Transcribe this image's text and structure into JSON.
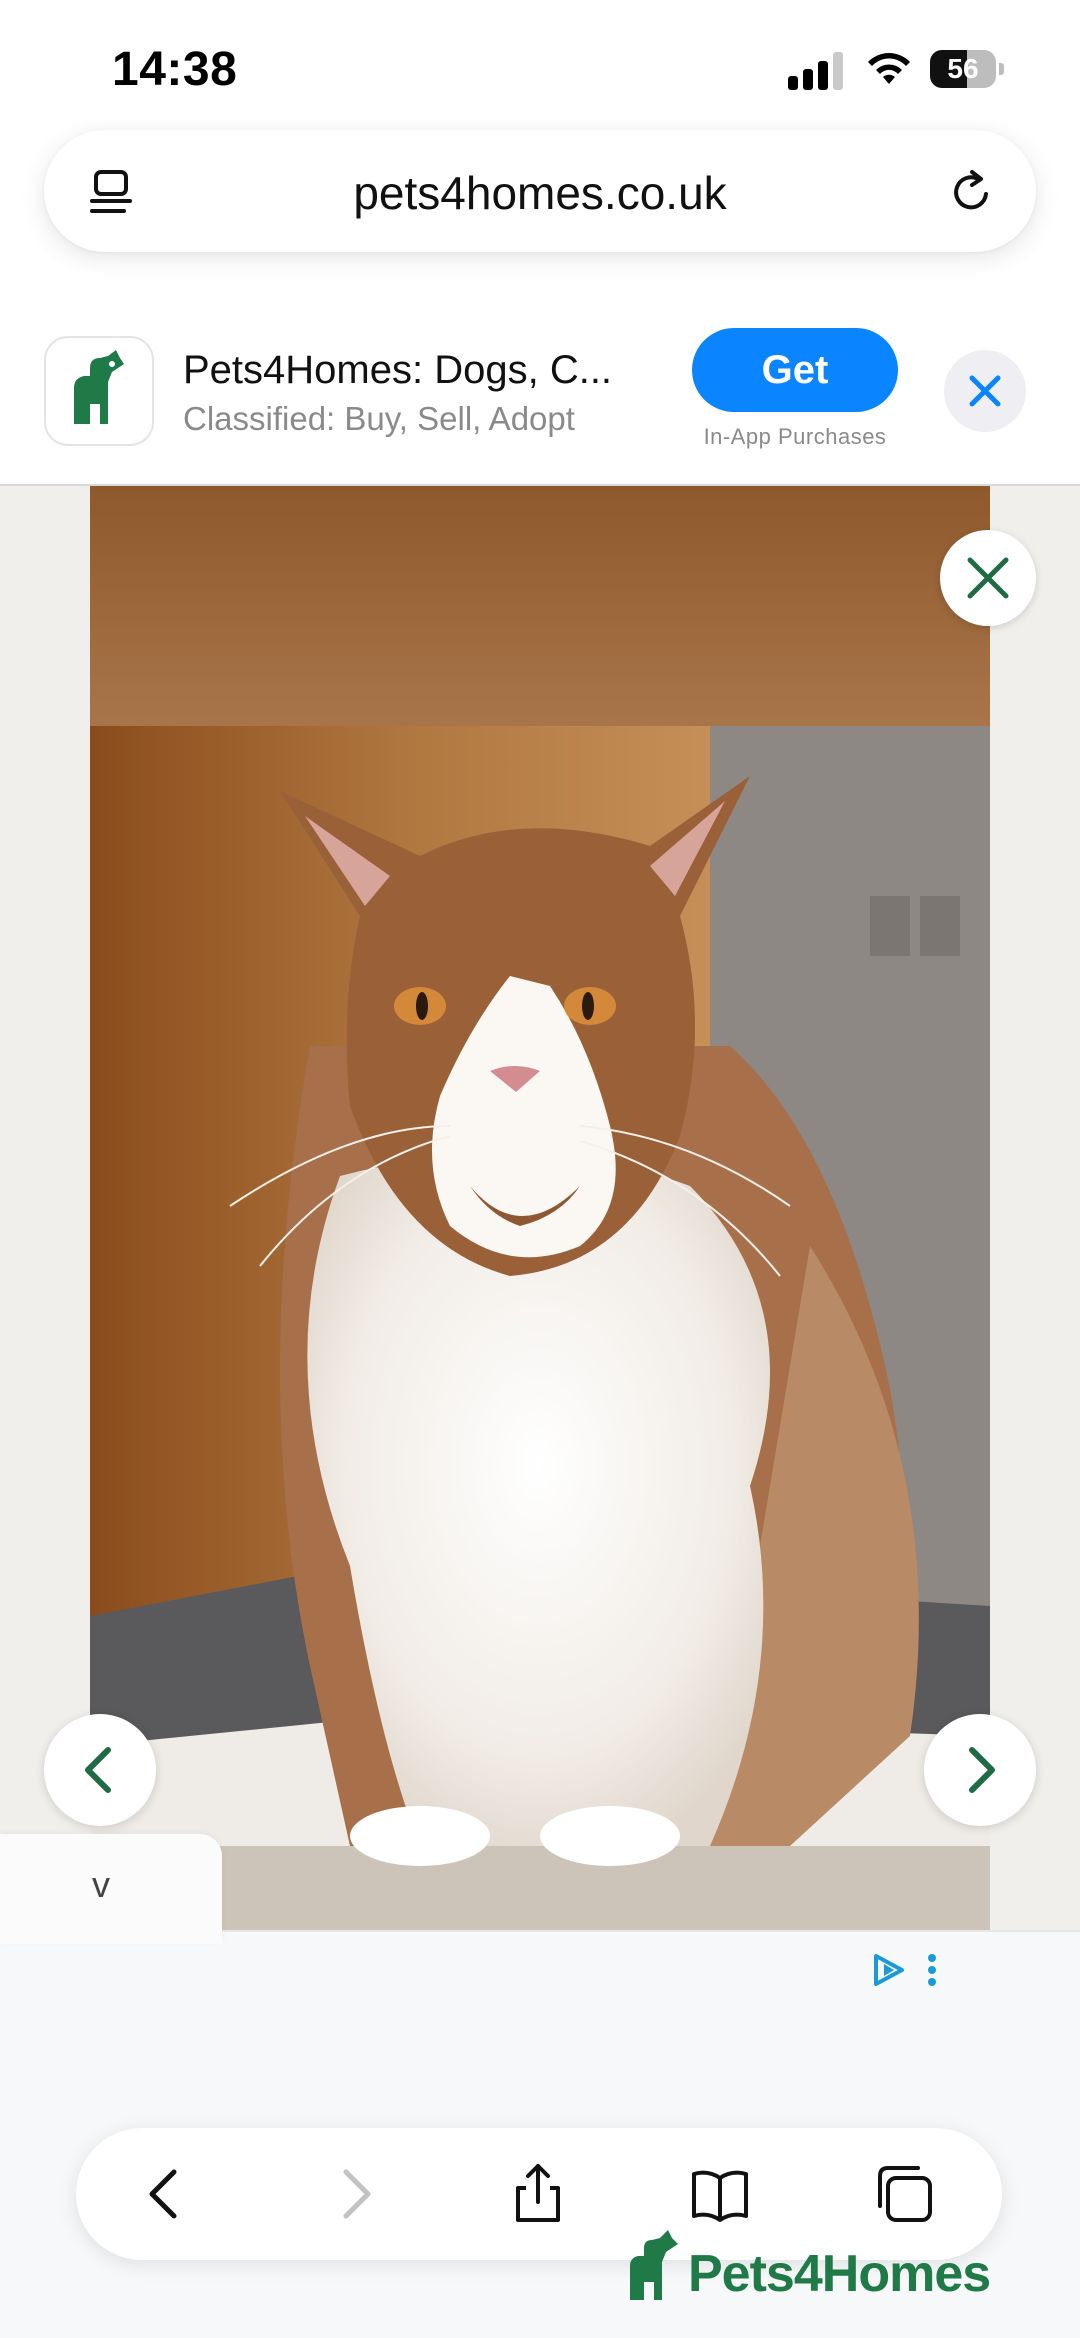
{
  "status_bar": {
    "time": "14:38",
    "battery_percent": "56",
    "signal_bars_active": 3,
    "signal_bars_total": 4
  },
  "url_bar": {
    "url": "pets4homes.co.uk",
    "left_icon": "page-menu-icon",
    "right_icon": "reload-icon"
  },
  "app_banner": {
    "title": "Pets4Homes: Dogs, C...",
    "subtitle": "Classified: Buy, Sell, Adopt",
    "get_label": "Get",
    "get_sublabel": "In-App Purchases",
    "get_color": "#0a84ff",
    "close_icon": "close-icon"
  },
  "viewer": {
    "photo_subject": "long-haired chocolate and white cat sitting",
    "close_icon": "close-icon",
    "prev_icon": "chevron-left-icon",
    "next_icon": "chevron-right-icon",
    "accent_color": "#1f6b45"
  },
  "collapse_tab": {
    "label": "v"
  },
  "ad": {
    "choices_icon": "adchoices-icon",
    "menu_icon": "more-vertical-icon"
  },
  "toolbar": {
    "items": [
      "back-icon",
      "forward-icon",
      "share-icon",
      "bookmarks-icon",
      "tabs-icon"
    ]
  },
  "watermark": {
    "text": "Pets4Homes",
    "color": "#1f7a47"
  }
}
